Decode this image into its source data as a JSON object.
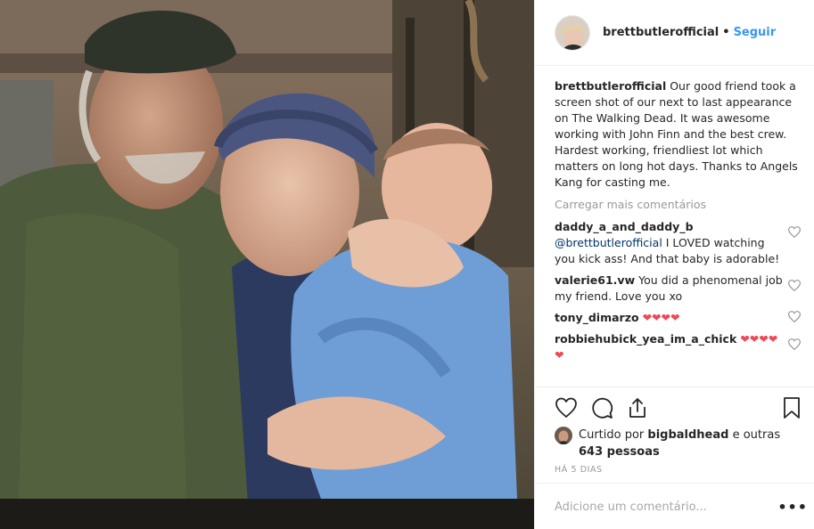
{
  "post": {
    "username": "brettbutlerofficial",
    "dot": "•",
    "follow_label": "Seguir",
    "caption": "Our good friend took a screen shot of our next to last appearance on The Walking Dead. It was awesome working with John Finn and the best crew. Hardest working, friendliest lot which matters on long hot days. Thanks to Angels Kang for casting me."
  },
  "comments": {
    "load_more": "Carregar mais comentários",
    "items": [
      {
        "user": "daddy_a_and_daddy_b",
        "mention": "@brettbutlerofficial",
        "text": " I LOVED watching you kick ass! And that baby is adorable!"
      },
      {
        "user": "valerie61.vw",
        "text": "You did a phenomenal job my friend. Love you xo"
      },
      {
        "user": "tony_dimarzo",
        "emoji": "❤❤❤❤"
      },
      {
        "user": "robbiehubick_yea_im_a_chick",
        "emoji": "❤❤❤❤❤"
      }
    ]
  },
  "likes": {
    "prefix": "Curtido por ",
    "user": "bigbaldhead",
    "middle": " e outras ",
    "count": "643 pessoas"
  },
  "timestamp": "HÁ 5 DIAS",
  "add_comment": {
    "placeholder": "Adicione um comentário...",
    "more": "•••"
  },
  "icons": {
    "like": "heart-icon",
    "comment": "comment-icon",
    "share": "share-icon",
    "save": "bookmark-icon",
    "comment_like": "small-heart-icon"
  },
  "colors": {
    "link": "#3897f0",
    "muted": "#999999",
    "heart": "#ed4956",
    "border": "#efefef"
  }
}
